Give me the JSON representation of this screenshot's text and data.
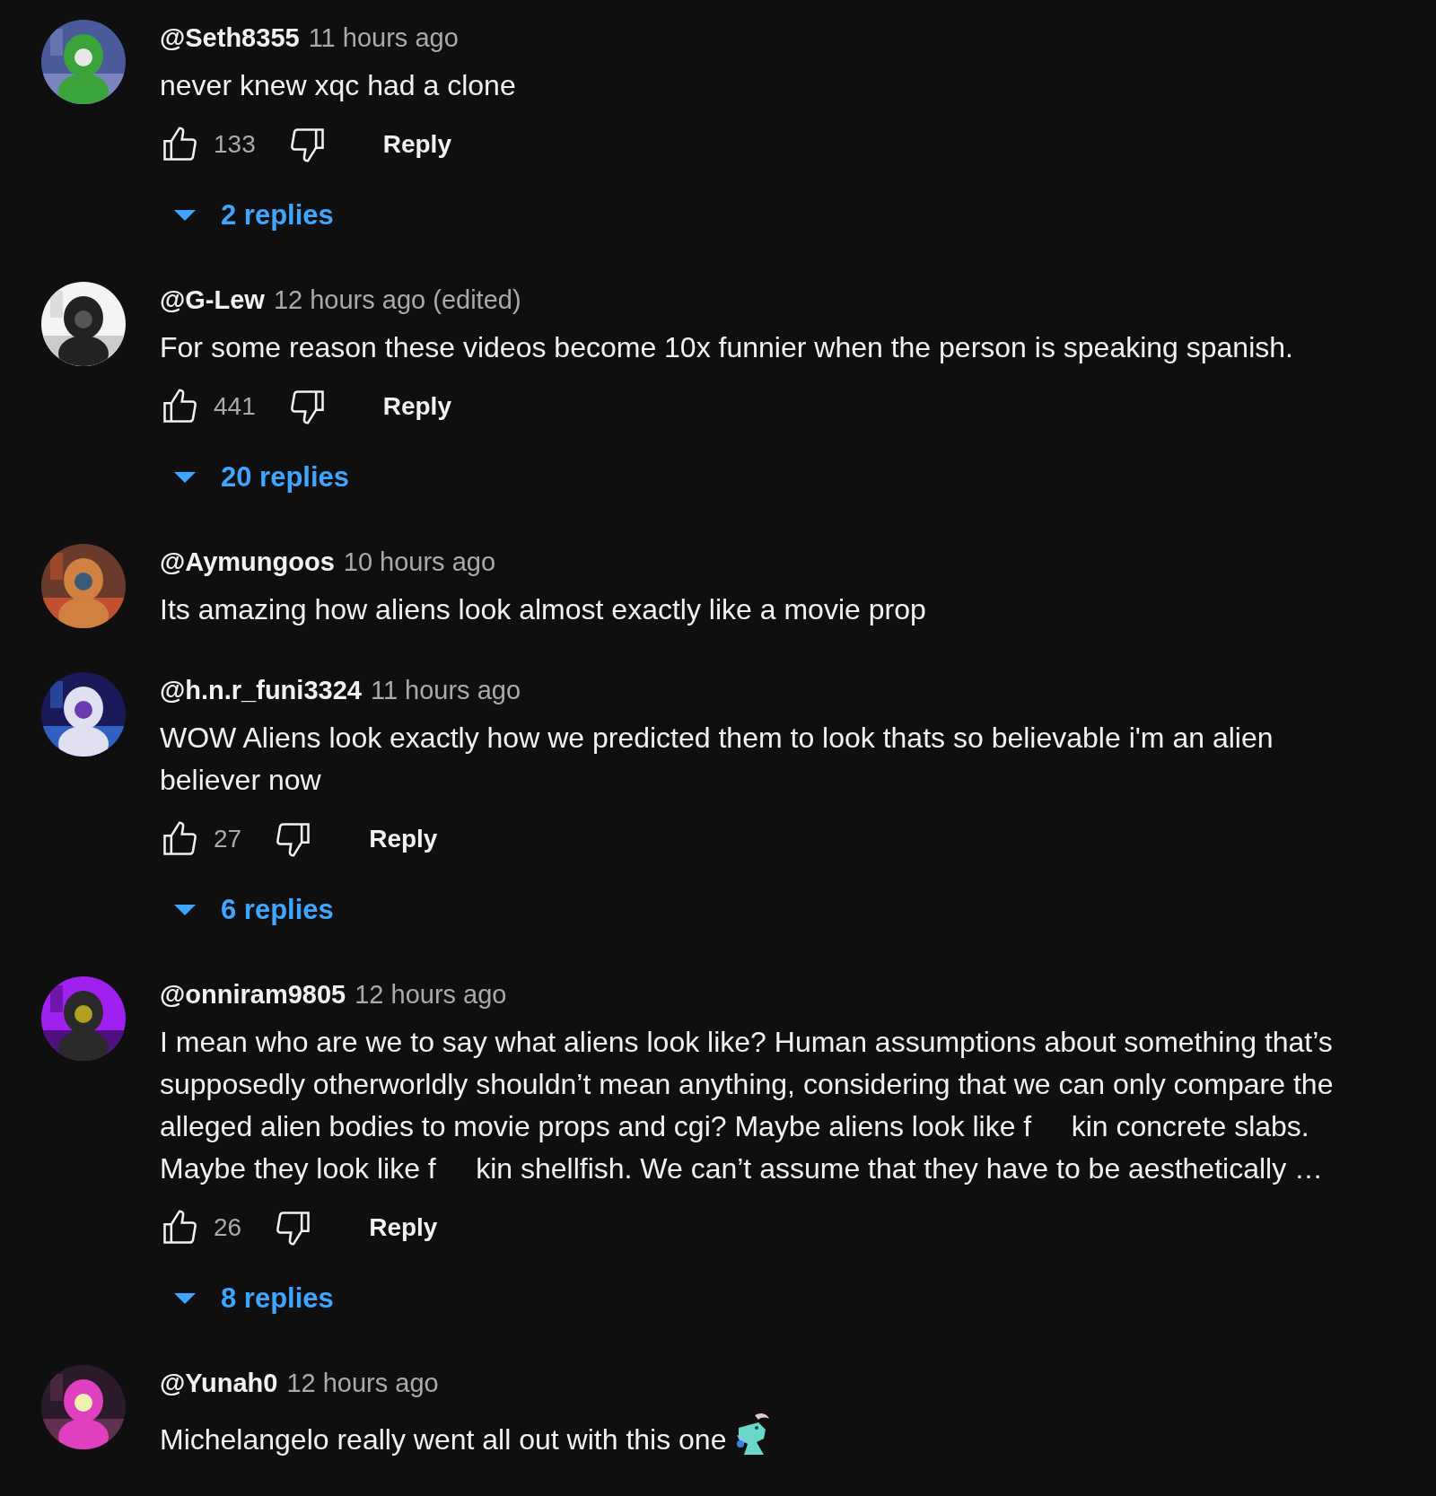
{
  "comments": [
    {
      "author": "@Seth8355",
      "time": "11 hours ago",
      "text": "never knew xqc had a clone",
      "likes": "133",
      "reply": "Reply",
      "replies": "2 replies"
    },
    {
      "author": "@G-Lew",
      "time": "12 hours ago (edited)",
      "text": "For some reason these videos become 10x funnier when the person is speaking spanish.",
      "likes": "441",
      "reply": "Reply",
      "replies": "20 replies"
    },
    {
      "author": "@Aymungoos",
      "time": "10 hours ago",
      "text": "Its amazing how aliens look almost exactly like a movie prop"
    },
    {
      "author": "@h.n.r_funi3324",
      "time": "11 hours ago",
      "text": "WOW Aliens look exactly how we predicted them to look thats so believable i'm an alien believer now",
      "likes": "27",
      "reply": "Reply",
      "replies": "6 replies"
    },
    {
      "author": "@onniram9805",
      "time": "12 hours ago",
      "text": "I mean who are we to say what aliens look like? Human assumptions about something that’s supposedly otherworldly shouldn’t mean anything, considering that we can only compare the alleged alien bodies to movie props and cgi? Maybe aliens look like f     kin concrete slabs. Maybe they look like f     kin shellfish. We can’t assume that they have to be aesthetically …",
      "likes": "26",
      "reply": "Reply",
      "replies": "8 replies"
    },
    {
      "author": "@Yunah0",
      "time": "12 hours ago",
      "text": "Michelangelo really went all out with this one",
      "emoji": true
    }
  ]
}
